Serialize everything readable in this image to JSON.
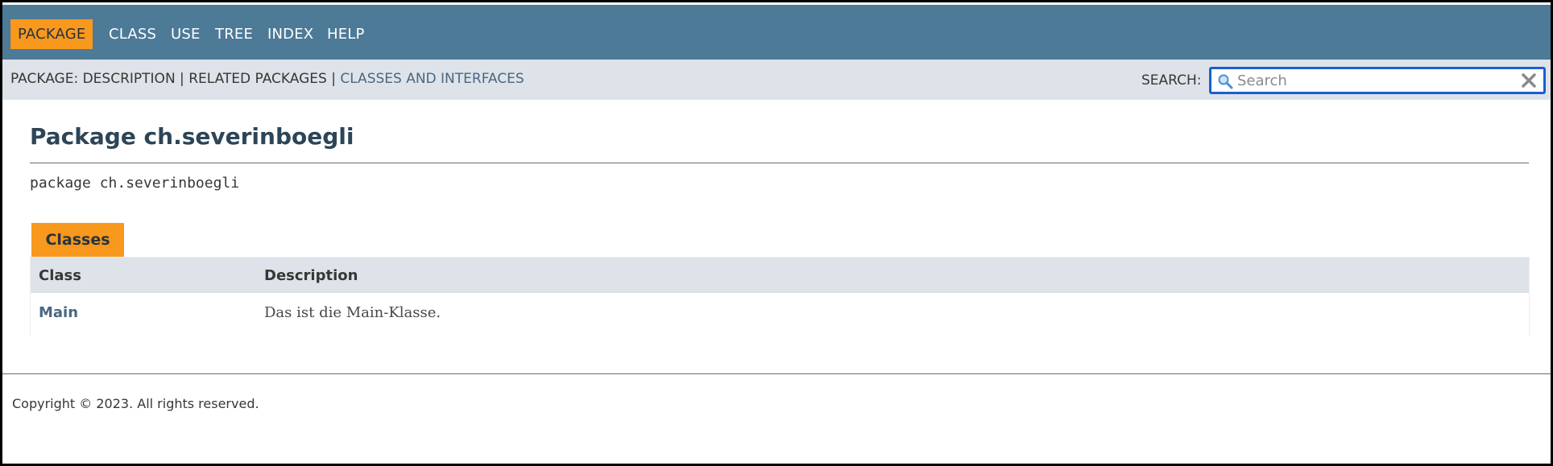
{
  "topnav": {
    "items": [
      {
        "label": "PACKAGE",
        "active": true
      },
      {
        "label": "CLASS",
        "active": false
      },
      {
        "label": "USE",
        "active": false
      },
      {
        "label": "TREE",
        "active": false
      },
      {
        "label": "INDEX",
        "active": false
      },
      {
        "label": "HELP",
        "active": false
      }
    ],
    "bg_color": "#4d7a97",
    "active_color": "#f8981d"
  },
  "subnav": {
    "prefix": "PACKAGE: DESCRIPTION | RELATED PACKAGES | ",
    "link_label": "CLASSES AND INTERFACES",
    "search_label": "SEARCH:",
    "search_placeholder": "Search",
    "search_icon": "search-icon",
    "reset_icon": "close-icon"
  },
  "main": {
    "title": "Package ch.severinboegli",
    "signature": "package ch.severinboegli",
    "classes_tab_label": "Classes",
    "table": {
      "headers": [
        "Class",
        "Description"
      ],
      "rows": [
        {
          "class": "Main",
          "description": "Das ist die Main-Klasse."
        }
      ]
    }
  },
  "footer": {
    "copyright": "Copyright © 2023. All rights reserved."
  }
}
